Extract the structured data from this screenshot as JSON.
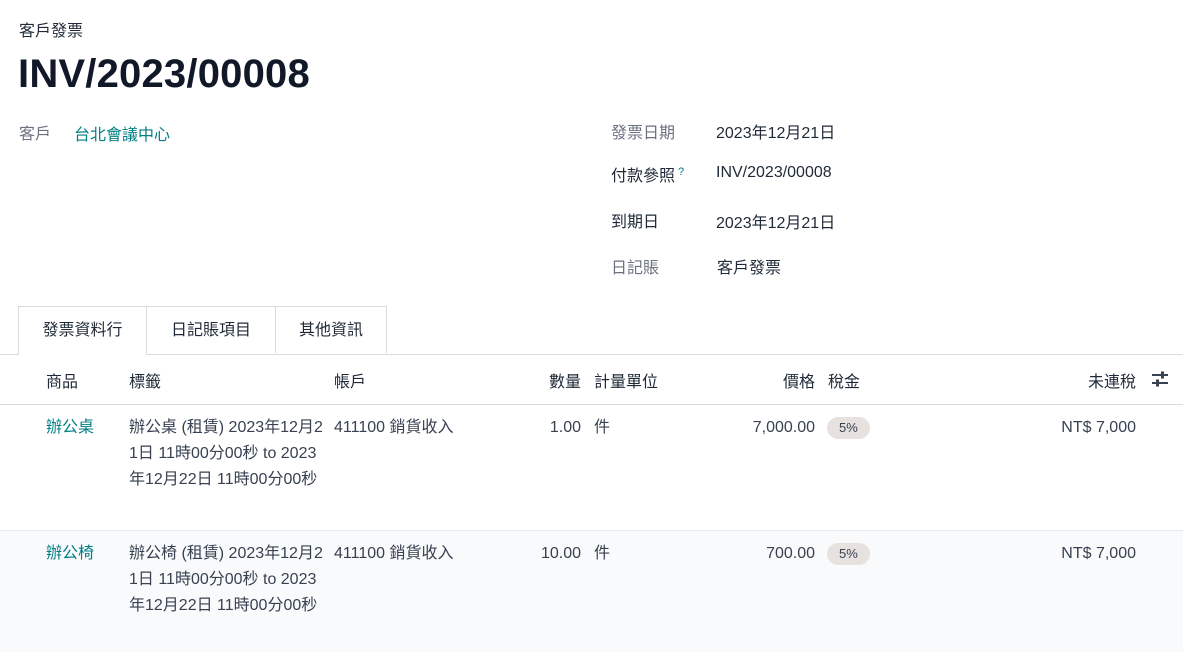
{
  "header": {
    "subtitle": "客戶發票",
    "title": "INV/2023/00008"
  },
  "fields": {
    "customer_label": "客戶",
    "customer_value": "台北會議中心",
    "invoice_date_label": "發票日期",
    "invoice_date_value": "2023年12月21日",
    "payment_ref_label": "付款參照",
    "payment_ref_help": "?",
    "payment_ref_value": "INV/2023/00008",
    "due_date_label": "到期日",
    "due_date_value": "2023年12月21日",
    "journal_label": "日記賬",
    "journal_value": "客戶發票"
  },
  "tabs": [
    {
      "label": "發票資料行"
    },
    {
      "label": "日記賬項目"
    },
    {
      "label": "其他資訊"
    }
  ],
  "table": {
    "headers": {
      "product": "商品",
      "label": "標籤",
      "account": "帳戶",
      "quantity": "數量",
      "uom": "計量單位",
      "price": "價格",
      "tax": "稅金",
      "subtotal": "未連稅"
    },
    "rows": [
      {
        "product": "辦公桌",
        "label": "辦公桌 (租賃) 2023年12月21日 11時00分00秒 to 2023年12月22日 11時00分00秒",
        "account": "411100 銷貨收入",
        "quantity": "1.00",
        "uom": "件",
        "price": "7,000.00",
        "tax": "5%",
        "subtotal": "NT$ 7,000"
      },
      {
        "product": "辦公椅",
        "label": "辦公椅 (租賃) 2023年12月21日 11時00分00秒 to 2023年12月22日 11時00分00秒",
        "account": "411100 銷貨收入",
        "quantity": "10.00",
        "uom": "件",
        "price": "700.00",
        "tax": "5%",
        "subtotal": "NT$ 7,000"
      }
    ]
  },
  "icons": {
    "column_settings": "sliders-icon"
  },
  "colors": {
    "link": "#017e84",
    "badge_bg": "#e7e2df"
  }
}
